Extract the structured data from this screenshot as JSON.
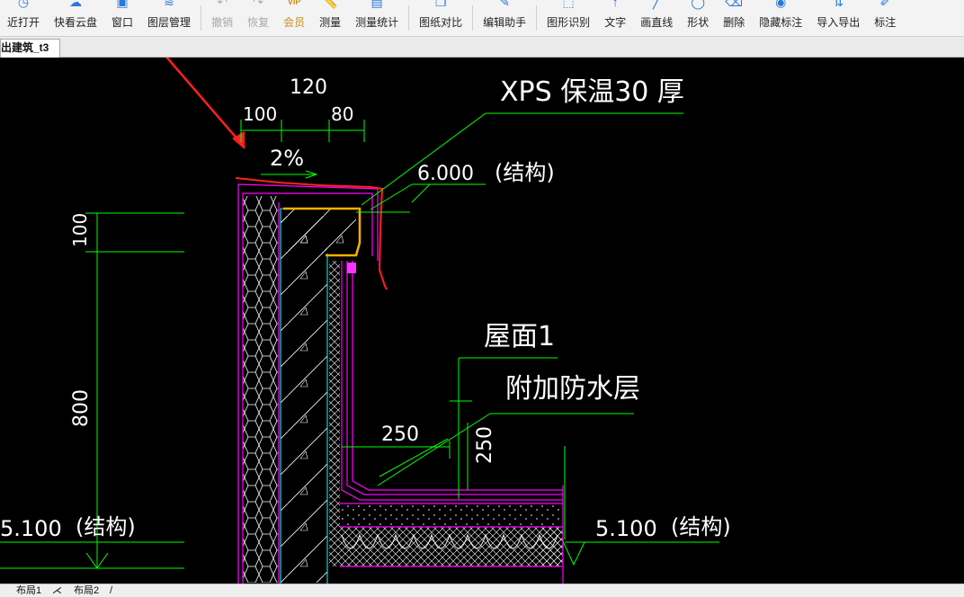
{
  "toolbar": {
    "items": [
      {
        "label": "近打开",
        "icon": "clock-icon",
        "enabled": true
      },
      {
        "label": "快看云盘",
        "icon": "cloud-icon",
        "enabled": true
      },
      {
        "label": "窗口",
        "icon": "window-icon",
        "enabled": true
      },
      {
        "label": "图层管理",
        "icon": "layers-icon",
        "enabled": true
      },
      {
        "label": "撤销",
        "icon": "undo-icon",
        "enabled": false
      },
      {
        "label": "恢复",
        "icon": "redo-icon",
        "enabled": false
      },
      {
        "label": "会员",
        "icon": "vip-icon",
        "enabled": true
      },
      {
        "label": "测量",
        "icon": "ruler-icon",
        "enabled": true
      },
      {
        "label": "测量统计",
        "icon": "measure-stats-icon",
        "enabled": true
      },
      {
        "label": "图纸对比",
        "icon": "compare-icon",
        "enabled": true
      },
      {
        "label": "编辑助手",
        "icon": "edit-helper-icon",
        "enabled": true
      },
      {
        "label": "图形识别",
        "icon": "shape-recognize-icon",
        "enabled": true
      },
      {
        "label": "文字",
        "icon": "text-icon",
        "enabled": true
      },
      {
        "label": "画直线",
        "icon": "line-icon",
        "enabled": true
      },
      {
        "label": "形状",
        "icon": "shape-icon",
        "enabled": true
      },
      {
        "label": "删除",
        "icon": "eraser-icon",
        "enabled": true
      },
      {
        "label": "隐藏标注",
        "icon": "hide-eye-icon",
        "enabled": true
      },
      {
        "label": "导入导出",
        "icon": "import-export-icon",
        "enabled": true
      },
      {
        "label": "标注",
        "icon": "annotate-icon",
        "enabled": true
      }
    ],
    "vip_badge": "VIP"
  },
  "document_tab": {
    "label": "出建筑_t3"
  },
  "drawing": {
    "dim_120": "120",
    "dim_100_top": "100",
    "dim_80": "80",
    "slope": "2%",
    "xps_note": "XPS 保温30 厚",
    "level_6000": "6.000",
    "structure_1": "(结构)",
    "dim_100_side": "100",
    "dim_800": "800",
    "roof_label": "屋面1",
    "waterproof_label": "附加防水层",
    "dim_250_h": "250",
    "dim_250_v": "250",
    "level_5100_left": "5.100",
    "structure_left": "(结构)",
    "level_5100_right": "5.100",
    "structure_right": "(结构)"
  },
  "colors": {
    "canvas": "#000000",
    "dimension": "#00ff00",
    "text": "#ffffff",
    "wall_outline": "#ff00ff",
    "waterproof": "#ff33ff",
    "insulation": "#ffffff",
    "concrete": "#00ffff",
    "annotation_red": "#ff2020",
    "annotation_yellow": "#ffb000"
  },
  "layout_tabs": [
    {
      "label": "布局1"
    },
    {
      "label": "布局2"
    }
  ]
}
